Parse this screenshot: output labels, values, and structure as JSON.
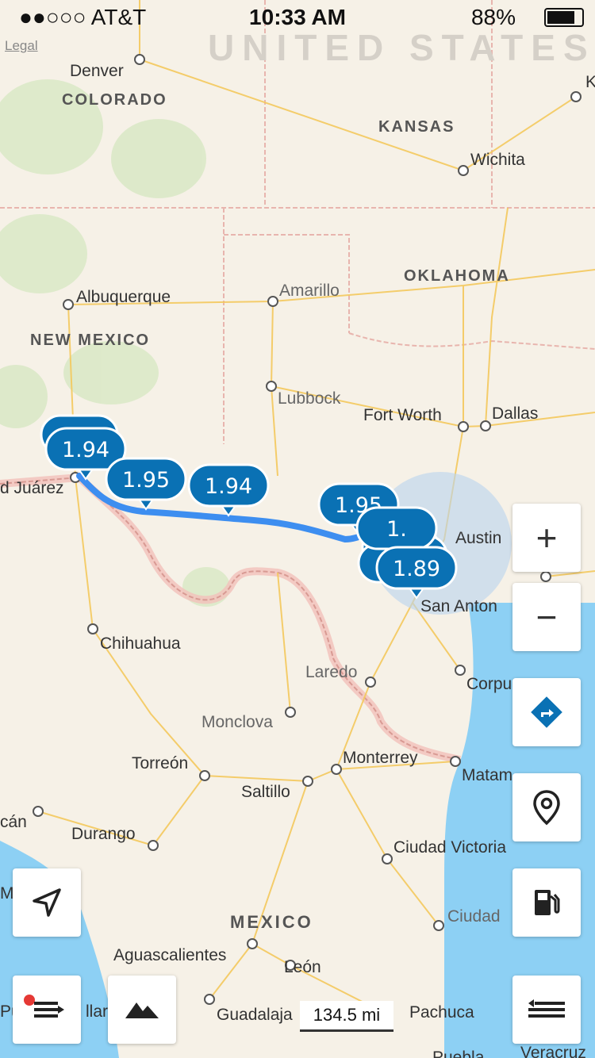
{
  "status_bar": {
    "carrier": "●●○○○ AT&T",
    "time": "10:33 AM",
    "battery": "88%"
  },
  "map": {
    "legal_label": "Legal",
    "country_label": "UNITED STATES",
    "region_labels": [
      "COLORADO",
      "KANSAS",
      "OKLAHOMA",
      "NEW MEXICO",
      "MEXICO"
    ],
    "city_labels": [
      "Denver",
      "Wichita",
      "Albuquerque",
      "Amarillo",
      "Lubbock",
      "Fort Worth",
      "Dallas",
      "d Juárez",
      "Austin",
      "San Anton",
      "Chihuahua",
      "Laredo",
      "Monclova",
      "Corpu",
      "Torreón",
      "Monterrey",
      "Matam",
      "Saltillo",
      "cán",
      "Durango",
      "Ciudad Victoria",
      "Ma",
      "Ciudad",
      "Aguascalientes",
      "León",
      "Guadalaja",
      "Pachuca",
      "Pu",
      "llar",
      "Veracruz",
      "Puebla",
      "K"
    ],
    "price_pins": [
      "1.94",
      "1.95",
      "1.94",
      "1.95",
      "1.",
      "1.89"
    ],
    "scale_label": "134.5 mi"
  },
  "controls": {
    "zoom_in": "+",
    "zoom_out": "−"
  },
  "colors": {
    "pin_blue": "#0a71b4",
    "route_blue": "#3d8ef0",
    "water": "#8dd0f4",
    "land": "#f6f1e7",
    "road": "#f4c95d"
  }
}
